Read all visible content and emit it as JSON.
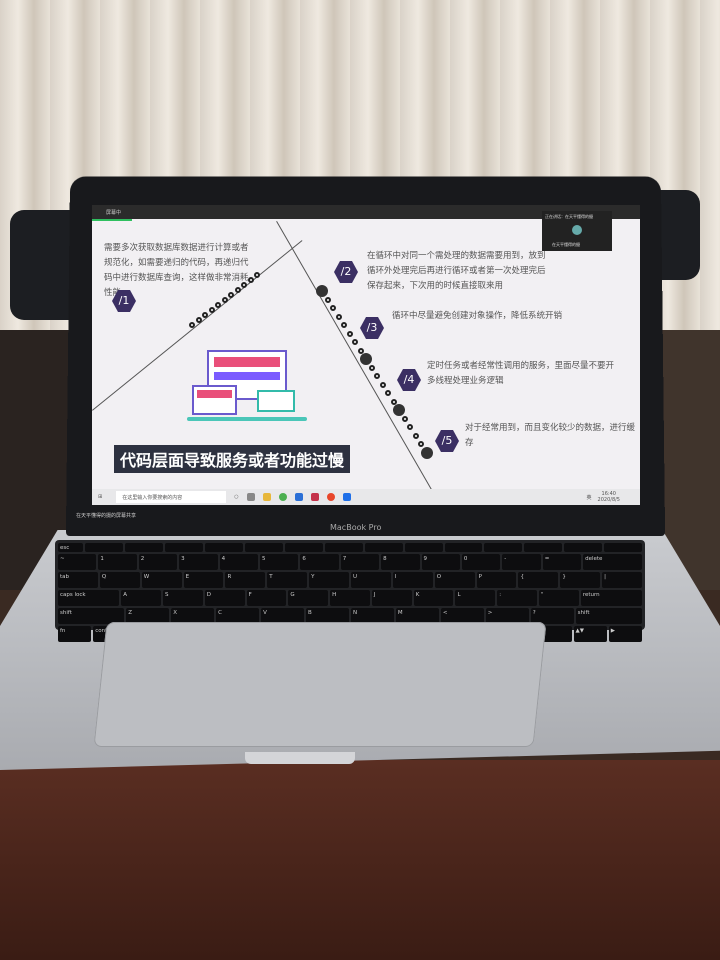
{
  "slide": {
    "meeting_bar": "屏幕中",
    "title": "代码层面导致服务或者功能过慢",
    "items": [
      {
        "num": "/1",
        "text": "需要多次获取数据库数据进行计算或者规范化，如需要递归的代码，再递归代码中进行数据库查询，这样做非常消耗性能"
      },
      {
        "num": "/2",
        "text": "在循环中对同一个需处理的数据需要用到，放到循环外处理完后再进行循环或者第一次处理完后保存起来，下次用的时候直接取来用"
      },
      {
        "num": "/3",
        "text": "循环中尽量避免创建对象操作，降低系统开销"
      },
      {
        "num": "/4",
        "text": "定时任务或者经常性调用的服务，里面尽量不要开多线程处理业务逻辑"
      },
      {
        "num": "/5",
        "text": "对于经常用到，而且变化较少的数据，进行缓存"
      }
    ]
  },
  "video": {
    "header": "正在讲话：在天平懂得的摄",
    "name": "在天平懂得的摄"
  },
  "taskbar": {
    "search_placeholder": "在这里输入你要搜索的内容",
    "time": "16:40",
    "date": "2020/8/5",
    "tray_lang": "英"
  },
  "meeting_status": "在天平懂得的摄的屏幕共享",
  "laptop_brand": "MacBook Pro",
  "keyboard": {
    "rows": [
      [
        "esc",
        "",
        "",
        "",
        "",
        "",
        "",
        "",
        "",
        "",
        "",
        "",
        "",
        "",
        ""
      ],
      [
        "~",
        "1",
        "2",
        "3",
        "4",
        "5",
        "6",
        "7",
        "8",
        "9",
        "0",
        "-",
        "=",
        "delete"
      ],
      [
        "tab",
        "Q",
        "W",
        "E",
        "R",
        "T",
        "Y",
        "U",
        "I",
        "O",
        "P",
        "{",
        "}",
        "|"
      ],
      [
        "caps lock",
        "A",
        "S",
        "D",
        "F",
        "G",
        "H",
        "J",
        "K",
        "L",
        ":",
        "\"",
        "return"
      ],
      [
        "shift",
        "Z",
        "X",
        "C",
        "V",
        "B",
        "N",
        "M",
        "<",
        ">",
        "?",
        "shift"
      ],
      [
        "fn",
        "control",
        "option",
        "command",
        "",
        "command",
        "option",
        "◀",
        "▲▼",
        "▶"
      ]
    ]
  }
}
